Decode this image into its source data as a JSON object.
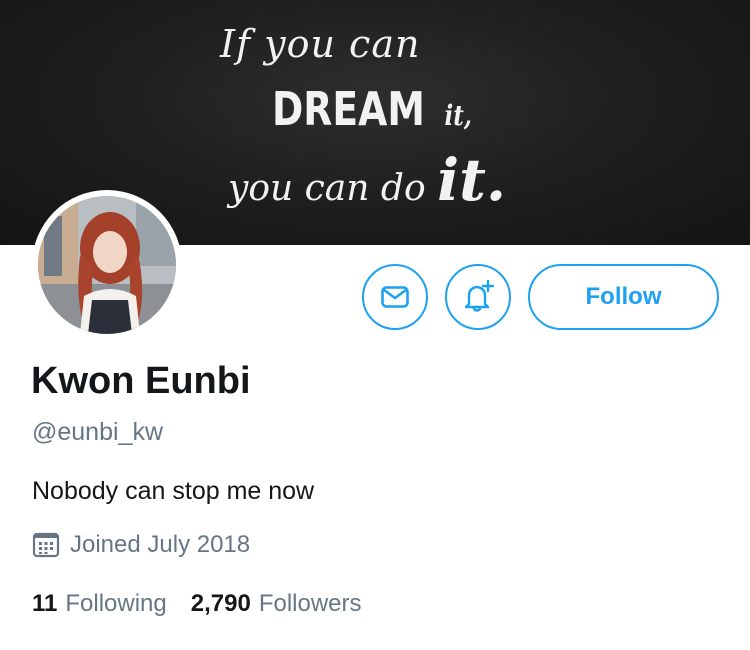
{
  "banner": {
    "line1": "If you can",
    "line2_big": "DREAM",
    "line2_small": "it,",
    "line3_small": "you can do",
    "line3_big": "it."
  },
  "profile": {
    "name": "Kwon Eunbi",
    "handle": "@eunbi_kw",
    "bio": "Nobody can stop me now",
    "joined": "Joined July 2018"
  },
  "actions": {
    "message_icon": "envelope-icon",
    "notify_icon": "bell-plus-icon",
    "follow_label": "Follow"
  },
  "stats": {
    "following_count": "11",
    "following_label": "Following",
    "followers_count": "2,790",
    "followers_label": "Followers"
  },
  "colors": {
    "accent": "#1da1f2",
    "text": "#14171a",
    "muted": "#657786",
    "banner_bg": "#1d1d1d"
  }
}
